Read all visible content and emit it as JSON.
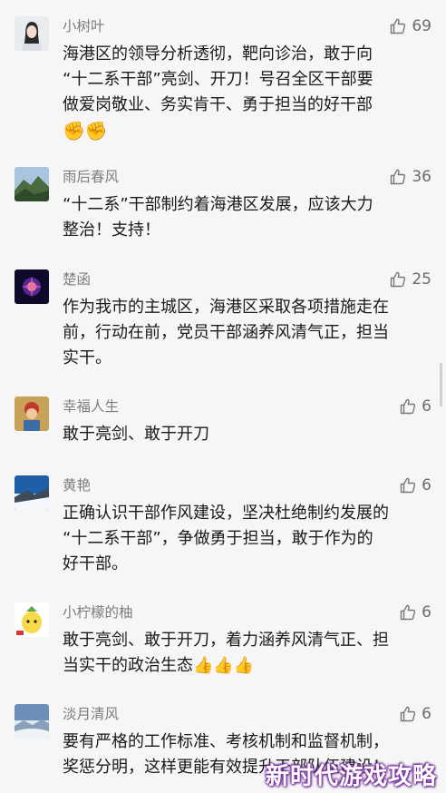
{
  "comments": [
    {
      "nickname": "小树叶",
      "likes": "69",
      "lines": [
        "海港区的领导分析透彻，靶向诊治，敢于向",
        "“十二系干部”亮剑、开刀！号召全区干部要",
        "做爱岗敬业、务实肯干、勇于担当的好干部"
      ],
      "emoji_line": "✊✊"
    },
    {
      "nickname": "雨后春风",
      "likes": "36",
      "lines": [
        "“十二系”干部制约着海港区发展，应该大力",
        "整治！支持！"
      ]
    },
    {
      "nickname": "楚函",
      "likes": "25",
      "lines": [
        "作为我市的主城区，海港区采取各项措施走在",
        "前，行动在前，党员干部涵养风清气正，担当",
        "实干。"
      ]
    },
    {
      "nickname": "幸福人生",
      "likes": "6",
      "lines": [
        "敢于亮剑、敢于开刀"
      ]
    },
    {
      "nickname": "黄艳",
      "likes": "6",
      "lines": [
        "正确认识干部作风建设，坚决杜绝制约发展的",
        "“十二系干部”，争做勇于担当，敢于作为的",
        "好干部。"
      ]
    },
    {
      "nickname": "小柠檬的柚",
      "likes": "6",
      "lines": [
        "敢于亮剑、敢于开刀，着力涵养风清气正、担",
        "当实干的政治生态"
      ],
      "trailing_emoji": "👍👍👍"
    },
    {
      "nickname": "淡月清风",
      "likes": "6",
      "lines": [
        "要有严格的工作标准、考核机制和监督机制，",
        "奖惩分明，这样更能有效提升干部队伍建设！"
      ]
    }
  ],
  "icons": {
    "like": "thumbs-up-outline-icon"
  },
  "watermark": "新时代游戏攻略"
}
